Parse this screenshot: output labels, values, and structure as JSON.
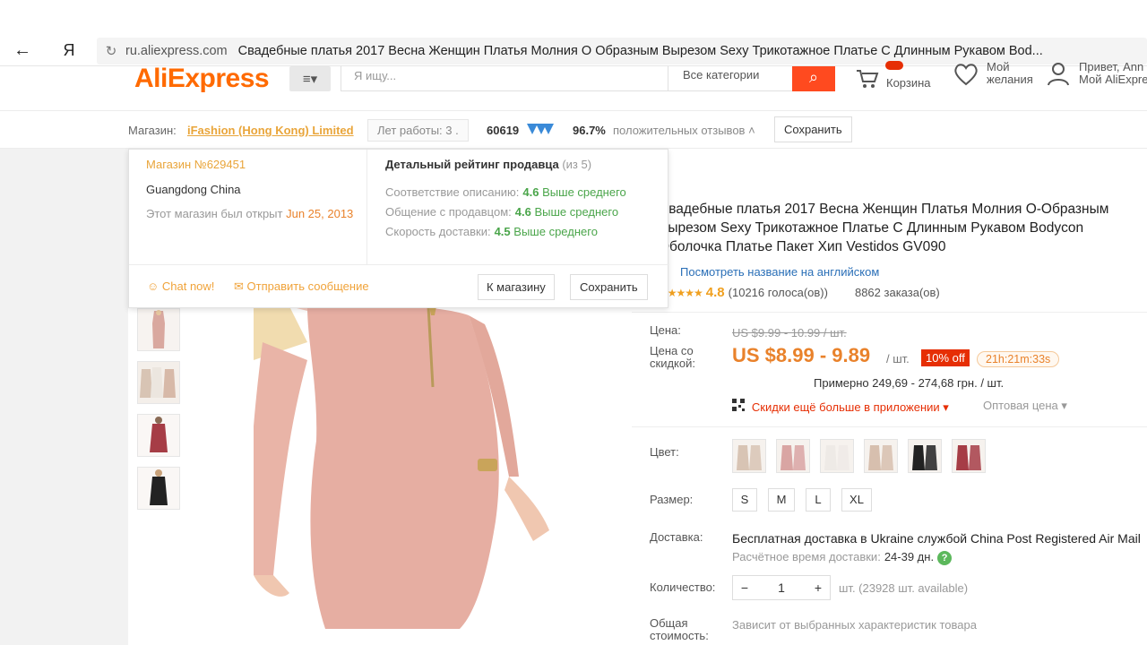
{
  "browser": {
    "back_icon": "←",
    "yandex_logo": "Я",
    "reload_icon": "↻",
    "url_domain": "ru.aliexpress.com",
    "page_title": "Свадебные платья 2017 Весна Женщин Платья Молния О Образным Вырезом Sexy Трикотажное Платье С Длинным Рукавом Bod..."
  },
  "header": {
    "logo": "AliExpress",
    "categories_icon": "≡▾",
    "search_placeholder": "Я ищу...",
    "search_category": "Все категории",
    "search_icon": "⌕",
    "cart_label": "Корзина",
    "wishlist_line1": "Мой",
    "wishlist_line2": "желания",
    "account_line1": "Привет, Ann",
    "account_line2": "Мой AliExpre"
  },
  "store": {
    "label": "Магазин:",
    "name": "iFashion (Hong Kong) Limited",
    "years": "Лет работы: 3 .",
    "feedback_score": "60619",
    "positive_pct": "96.7%",
    "positive_label": "положительных отзывов ˄",
    "save_label": "Сохранить"
  },
  "popup": {
    "store_no": "Магазин №629451",
    "location": "Guangdong China",
    "opened_label": "Этот магазин был открыт ",
    "opened_date": "Jun 25, 2013",
    "rating_title": "Детальный рейтинг продавца",
    "rating_note": " (из 5)",
    "rows": [
      {
        "label": "Соответствие описанию:",
        "value": "4.6",
        "compare": "Выше среднего"
      },
      {
        "label": "Общение с продавцом:",
        "value": "4.6",
        "compare": "Выше среднего"
      },
      {
        "label": "Скорость доставки:",
        "value": "4.5",
        "compare": "Выше среднего"
      }
    ],
    "chat_label": "☺ Chat now!",
    "message_label": "✉ Отправить сообщение",
    "to_store_label": "К магазину",
    "save_label": "Сохранить"
  },
  "product": {
    "title": "Свадебные платья 2017 Весна Женщин Платья Молния О-Образным Вырезом Sexy Трикотажное Платье С Длинным Рукавом Bodycon Оболочка Платье Пакет Хип Vestidos GV090",
    "english_link": "Посмотреть название на английском",
    "stars": "★★★★★",
    "rating": "4.8",
    "votes": "(10216 голоса(ов))",
    "orders": "8862 заказа(ов)",
    "price_label": "Цена:",
    "price_old": "US $9.99 - 10.99 / шт.",
    "discount_price_label_1": "Цена со",
    "discount_price_label_2": "скидкой:",
    "price_new": "US $8.99 - 9.89",
    "price_unit": "/ шт.",
    "discount_badge": "10% off",
    "timer": "21h:21m:33s",
    "approx": "Примерно 249,69 - 274,68 грн. / шт.",
    "app_promo": "Скидки ещё больше в приложении ▾",
    "wholesale": "Оптовая цена ▾",
    "color_label": "Цвет:",
    "colors": [
      "#d8c4b4",
      "#d9a5a3",
      "#eeeae6",
      "#d7bfae",
      "#222222",
      "#a63d46"
    ],
    "size_label": "Размер:",
    "sizes": [
      "S",
      "M",
      "L",
      "XL"
    ],
    "shipping_label": "Доставка:",
    "shipping_text": "Бесплатная доставка в Ukraine службой China Post Registered Air Mail",
    "shipping_time_label": "Расчётное время доставки:",
    "shipping_time_value": "24-39 дн.",
    "help_icon": "?",
    "qty_label": "Количество:",
    "qty_minus": "−",
    "qty_value": "1",
    "qty_plus": "+",
    "stock": "шт. (23928 шт. available)",
    "total_label_1": "Общая",
    "total_label_2": "стоимость:",
    "total_note": "Зависит от выбранных характеристик товара"
  },
  "colors": {
    "accent": "#ff6a00",
    "search_button": "#ff4a1f",
    "sale_red": "#e62e04",
    "price_orange": "#e9822b",
    "link_blue": "#2a6fb7",
    "rating_green": "#4aa54a"
  }
}
